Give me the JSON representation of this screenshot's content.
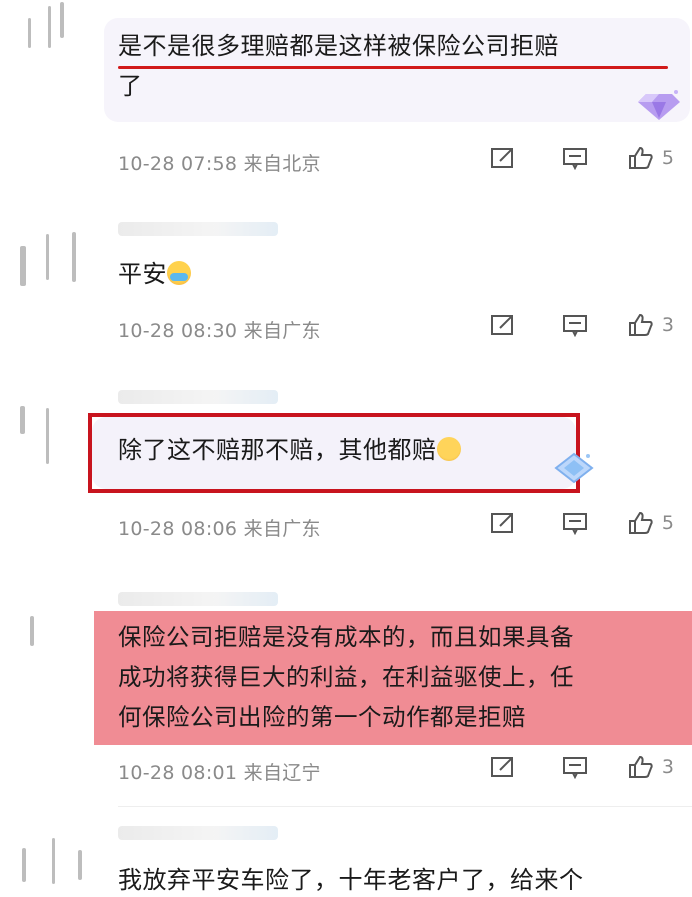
{
  "comments": [
    {
      "text_line1": "是不是很多理赔都是这样被保险公司拒赔",
      "text_line2": "了",
      "meta": "10-28 07:58 来自北京",
      "likes": "5"
    },
    {
      "text": "平安",
      "meta": "10-28 08:30 来自广东",
      "likes": "3"
    },
    {
      "text": "除了这不赔那不赔，其他都赔",
      "meta": "10-28 08:06 来自广东",
      "likes": "5"
    },
    {
      "text_line1": "保险公司拒赔是没有成本的，而且如果具备",
      "text_line2": "成功将获得巨大的利益，在利益驱使上，任",
      "text_line3": "何保险公司出险的第一个动作都是拒赔",
      "meta": "10-28 08:01 来自辽宁",
      "likes": "3"
    },
    {
      "text": "我放弃平安车险了，十年老客户了，给来个"
    }
  ],
  "icons": {
    "share": "share-icon",
    "reply": "comment-icon",
    "like": "thumbs-up-icon",
    "emoji_cry": "crying-emoji-icon",
    "emoji_smirk": "smirk-cat-emoji-icon",
    "badge": "diamond-badge-icon"
  },
  "colors": {
    "highlight_red": "#c8141e",
    "highlight_pink": "#f08c94",
    "meta_gray": "#8a8a8a"
  }
}
